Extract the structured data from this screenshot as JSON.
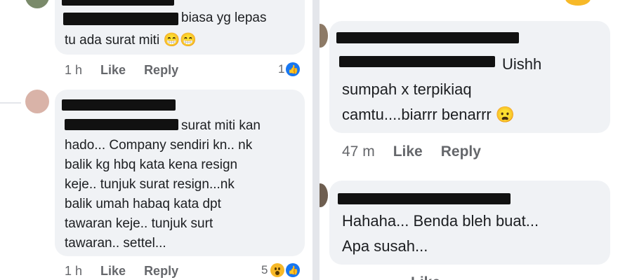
{
  "left": {
    "comment1": {
      "text_line1": "biasa yg lepas",
      "text_line2": "tu ada surat miti",
      "emoji": "😁😁",
      "time": "1 h",
      "like": "Like",
      "reply": "Reply",
      "reaction_count": "1",
      "reaction_icon": "like-icon"
    },
    "comment2": {
      "text_line1": "surat miti kan",
      "text_line2": "hado... Company sendiri kn.. nk",
      "text_line3": "balik kg hbq kata kena resign",
      "text_line4": "keje.. tunjuk surat resign...nk",
      "text_line5": "balik umah habaq kata dpt",
      "text_line6": "tawaran keje.. tunjuk surt",
      "text_line7": "tawaran.. settel...",
      "time": "1 h",
      "like": "Like",
      "reply": "Reply",
      "reaction_count": "5",
      "reaction_icons": [
        "wow-icon",
        "like-icon"
      ]
    }
  },
  "right": {
    "comment1": {
      "text_line1": "Uishh",
      "text_line2": "sumpah x terpikiaq",
      "text_line3": "camtu....biarrr benarrr",
      "emoji": "😦",
      "time": "47 m",
      "like": "Like",
      "reply": "Reply"
    },
    "comment2": {
      "text_line1": "Hahaha... Benda bleh buat...",
      "text_line2": "Apa susah...",
      "like": "Like"
    }
  },
  "colors": {
    "bubble": "#f0f2f5",
    "meta": "#65676b",
    "like_blue": "#1877f2",
    "wow_yellow": "#f7b928"
  }
}
